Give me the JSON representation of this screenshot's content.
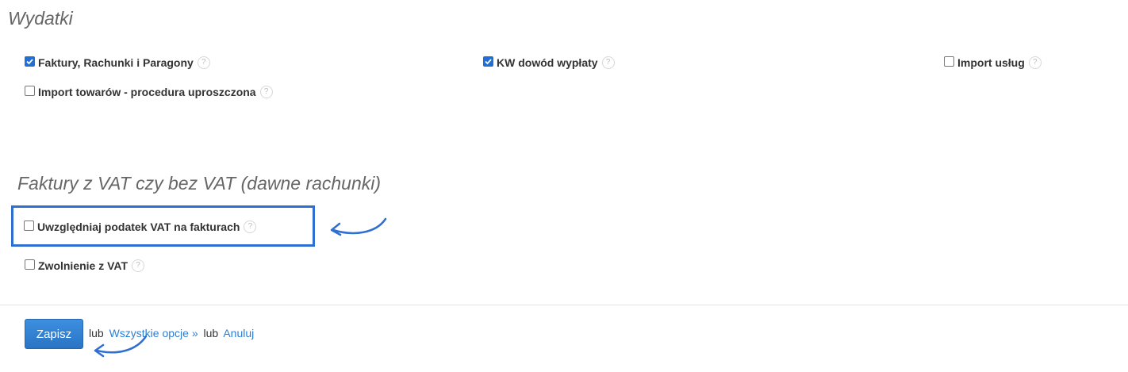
{
  "expenses": {
    "title": "Wydatki",
    "options": [
      {
        "label": "Faktury, Rachunki i Paragony",
        "checked": true,
        "help": "?"
      },
      {
        "label": "KW dowód wypłaty",
        "checked": true,
        "help": "?"
      },
      {
        "label": "Import usług",
        "checked": false,
        "help": "?"
      },
      {
        "label": "Import towarów - procedura uproszczona",
        "checked": false,
        "help": "?"
      }
    ]
  },
  "vat": {
    "title": "Faktury z VAT czy bez VAT (dawne rachunki)",
    "options": [
      {
        "label": "Uwzględniaj podatek VAT na fakturach",
        "checked": false,
        "help": "?"
      },
      {
        "label": "Zwolnienie z VAT",
        "checked": false,
        "help": "?"
      }
    ]
  },
  "footer": {
    "save_label": "Zapisz",
    "or_1": "lub",
    "all_options_label": "Wszystkie opcje »",
    "or_2": "lub",
    "cancel_label": "Anuluj"
  },
  "colors": {
    "accent": "#2f6fd0",
    "link": "#2a7fd4",
    "checkbox_checked": "#1f6fd6"
  }
}
